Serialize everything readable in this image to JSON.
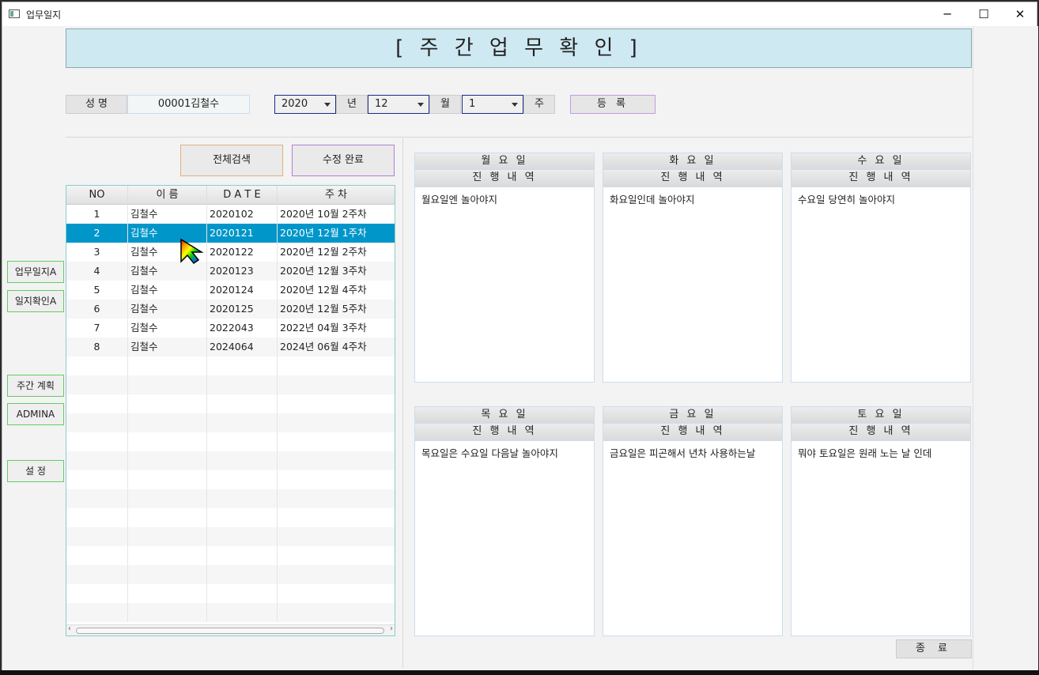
{
  "window": {
    "title": "업무일지",
    "minimize": "─",
    "maximize": "☐",
    "close": "✕"
  },
  "header": {
    "title": "[ 주 간  업 무  확 인 ]"
  },
  "form": {
    "name_label": "성    명",
    "name_value": "00001김철수",
    "year_value": "2020",
    "year_label": "년",
    "month_value": "12",
    "month_label": "월",
    "week_value": "1",
    "week_label": "주",
    "register_label": "등 록"
  },
  "actions": {
    "search_all": "전체검색",
    "edit_done": "수정 완료"
  },
  "sidebar": {
    "items": [
      {
        "label": "업무일지A"
      },
      {
        "label": "일지확인A"
      },
      {
        "label": "주간 계획"
      },
      {
        "label": "ADMINA"
      },
      {
        "label": "설    정"
      }
    ]
  },
  "table": {
    "columns": [
      "NO",
      "이    름",
      "D  A  T  E",
      "주 차"
    ],
    "rows": [
      [
        "1",
        "김철수",
        "2020102",
        "2020년 10월 2주차"
      ],
      [
        "2",
        "김철수",
        "2020121",
        "2020년 12월 1주차"
      ],
      [
        "3",
        "김철수",
        "2020122",
        "2020년 12월 2주차"
      ],
      [
        "4",
        "김철수",
        "2020123",
        "2020년 12월 3주차"
      ],
      [
        "5",
        "김철수",
        "2020124",
        "2020년 12월 4주차"
      ],
      [
        "6",
        "김철수",
        "2020125",
        "2020년 12월 5주차"
      ],
      [
        "7",
        "김철수",
        "2022043",
        "2022년 04월 3주차"
      ],
      [
        "8",
        "김철수",
        "2024064",
        "2024년 06월 4주차"
      ]
    ],
    "selected_row": 2
  },
  "days": [
    {
      "name": "월 요 일",
      "sub": "진 행 내 역",
      "content": "월요일엔 놀아야지"
    },
    {
      "name": "화 요 일",
      "sub": "진 행 내 역",
      "content": "화요일인데 놀아야지"
    },
    {
      "name": "수 요 일",
      "sub": "진 행 내 역",
      "content": "수요일 당연히 놀아야지"
    },
    {
      "name": "목 요 일",
      "sub": "진 행 내 역",
      "content": "목요일은 수요일 다음날 놀아야지"
    },
    {
      "name": "금 요 일",
      "sub": "진 행 내 역",
      "content": "금요일은 피곤해서 년차 사용하는날"
    },
    {
      "name": "토 요 일",
      "sub": "진 행 내 역",
      "content": "뭐야 토요일은 원래 노는 날 인데"
    }
  ],
  "footer": {
    "close_label": "종 료"
  }
}
